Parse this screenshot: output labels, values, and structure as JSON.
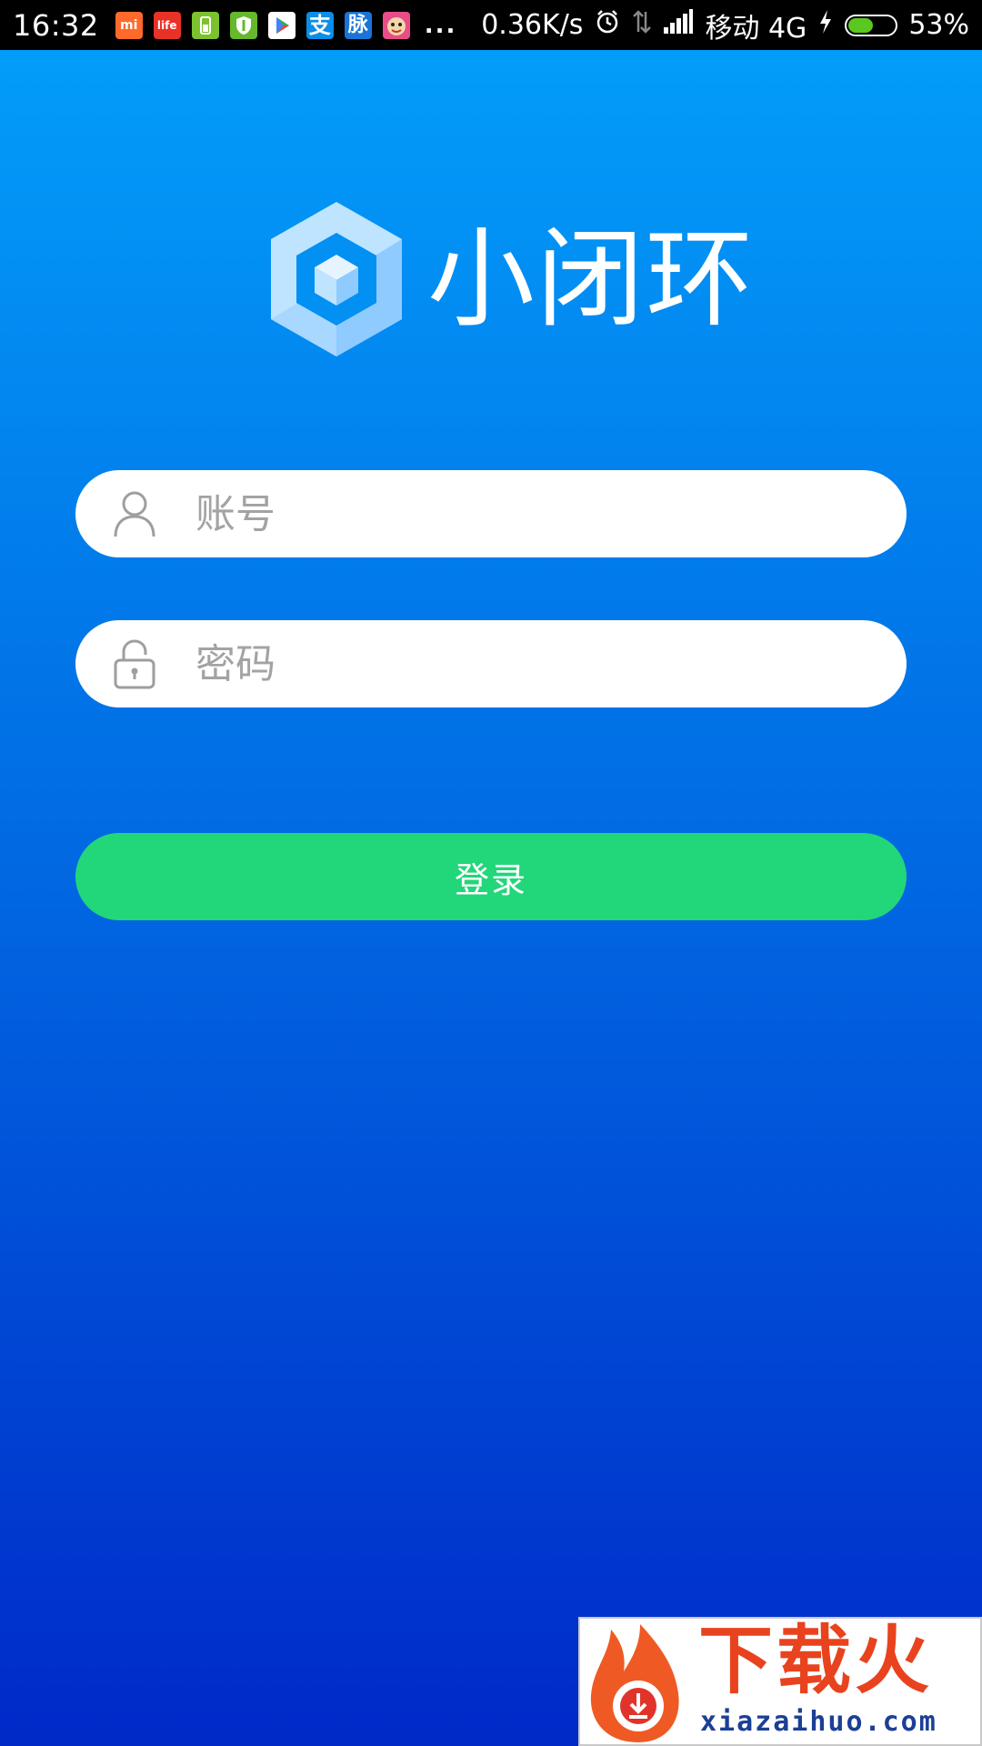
{
  "status_bar": {
    "time": "16:32",
    "network_speed": "0.36K/s",
    "carrier": "移动 4G",
    "battery": "53%",
    "battery_level": 0.53,
    "more_notifications": "...",
    "notification_icons": [
      {
        "name": "mi-store-icon",
        "label": "mi",
        "color": "#ff6a2b"
      },
      {
        "name": "life-app-icon",
        "label": "life",
        "color": "#e83227"
      },
      {
        "name": "battery-app-icon",
        "label": "",
        "color": "#7bc22e"
      },
      {
        "name": "security-app-icon",
        "label": "",
        "color": "#66b82c"
      },
      {
        "name": "play-store-icon",
        "label": "",
        "color": "#ffffff"
      },
      {
        "name": "alipay-icon",
        "label": "支",
        "color": "#0b8de8"
      },
      {
        "name": "maimai-icon",
        "label": "脉",
        "color": "#1a74d8"
      },
      {
        "name": "monkey-app-icon",
        "label": "",
        "color": "#e84d8a"
      }
    ]
  },
  "app": {
    "name": "小闭环"
  },
  "login": {
    "account_placeholder": "账号",
    "password_placeholder": "密码",
    "submit_label": "登录"
  },
  "colors": {
    "gradient_top": "#02a0fb",
    "gradient_bottom": "#0029c8",
    "login_button": "#22d67a",
    "placeholder": "#a3a3a3"
  },
  "watermark": {
    "title": "下载火",
    "url": "xiazaihuo.com"
  }
}
